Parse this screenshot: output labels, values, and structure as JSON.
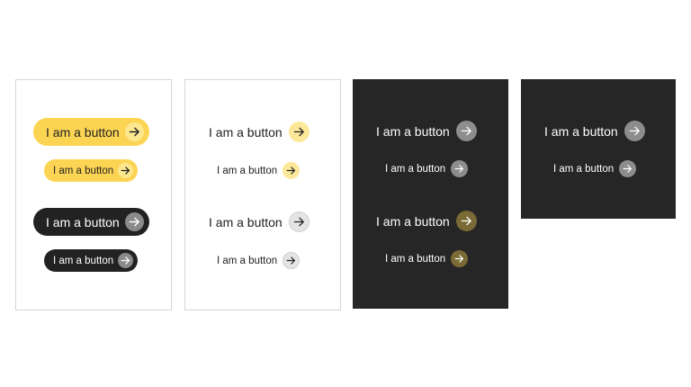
{
  "button_label": "I am a button",
  "icon": "arrow-right-icon",
  "colors": {
    "yellow": "#fcd453",
    "black": "#222222",
    "dark_panel": "#262626",
    "grey_arrow": "#8d8d8d",
    "olive_arrow": "#7a6a35"
  },
  "panels": [
    {
      "theme": "light",
      "style": "filled"
    },
    {
      "theme": "light",
      "style": "ghost"
    },
    {
      "theme": "dark",
      "style": "ghost"
    },
    {
      "theme": "dark",
      "style": "ghost"
    }
  ]
}
